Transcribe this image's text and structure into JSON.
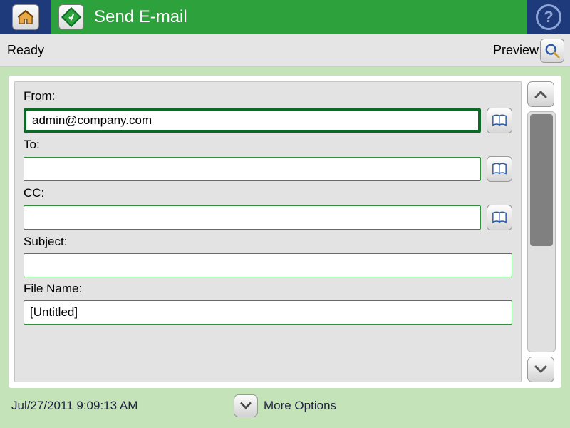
{
  "header": {
    "title": "Send E-mail"
  },
  "status": {
    "text": "Ready",
    "preview_label": "Preview"
  },
  "form": {
    "from_label": "From:",
    "from_value": "admin@company.com",
    "to_label": "To:",
    "to_value": "",
    "cc_label": "CC:",
    "cc_value": "",
    "subject_label": "Subject:",
    "subject_value": "",
    "filename_label": "File Name:",
    "filename_value": "[Untitled]"
  },
  "footer": {
    "timestamp": "Jul/27/2011 9:09:13 AM",
    "more_options_label": "More Options"
  }
}
